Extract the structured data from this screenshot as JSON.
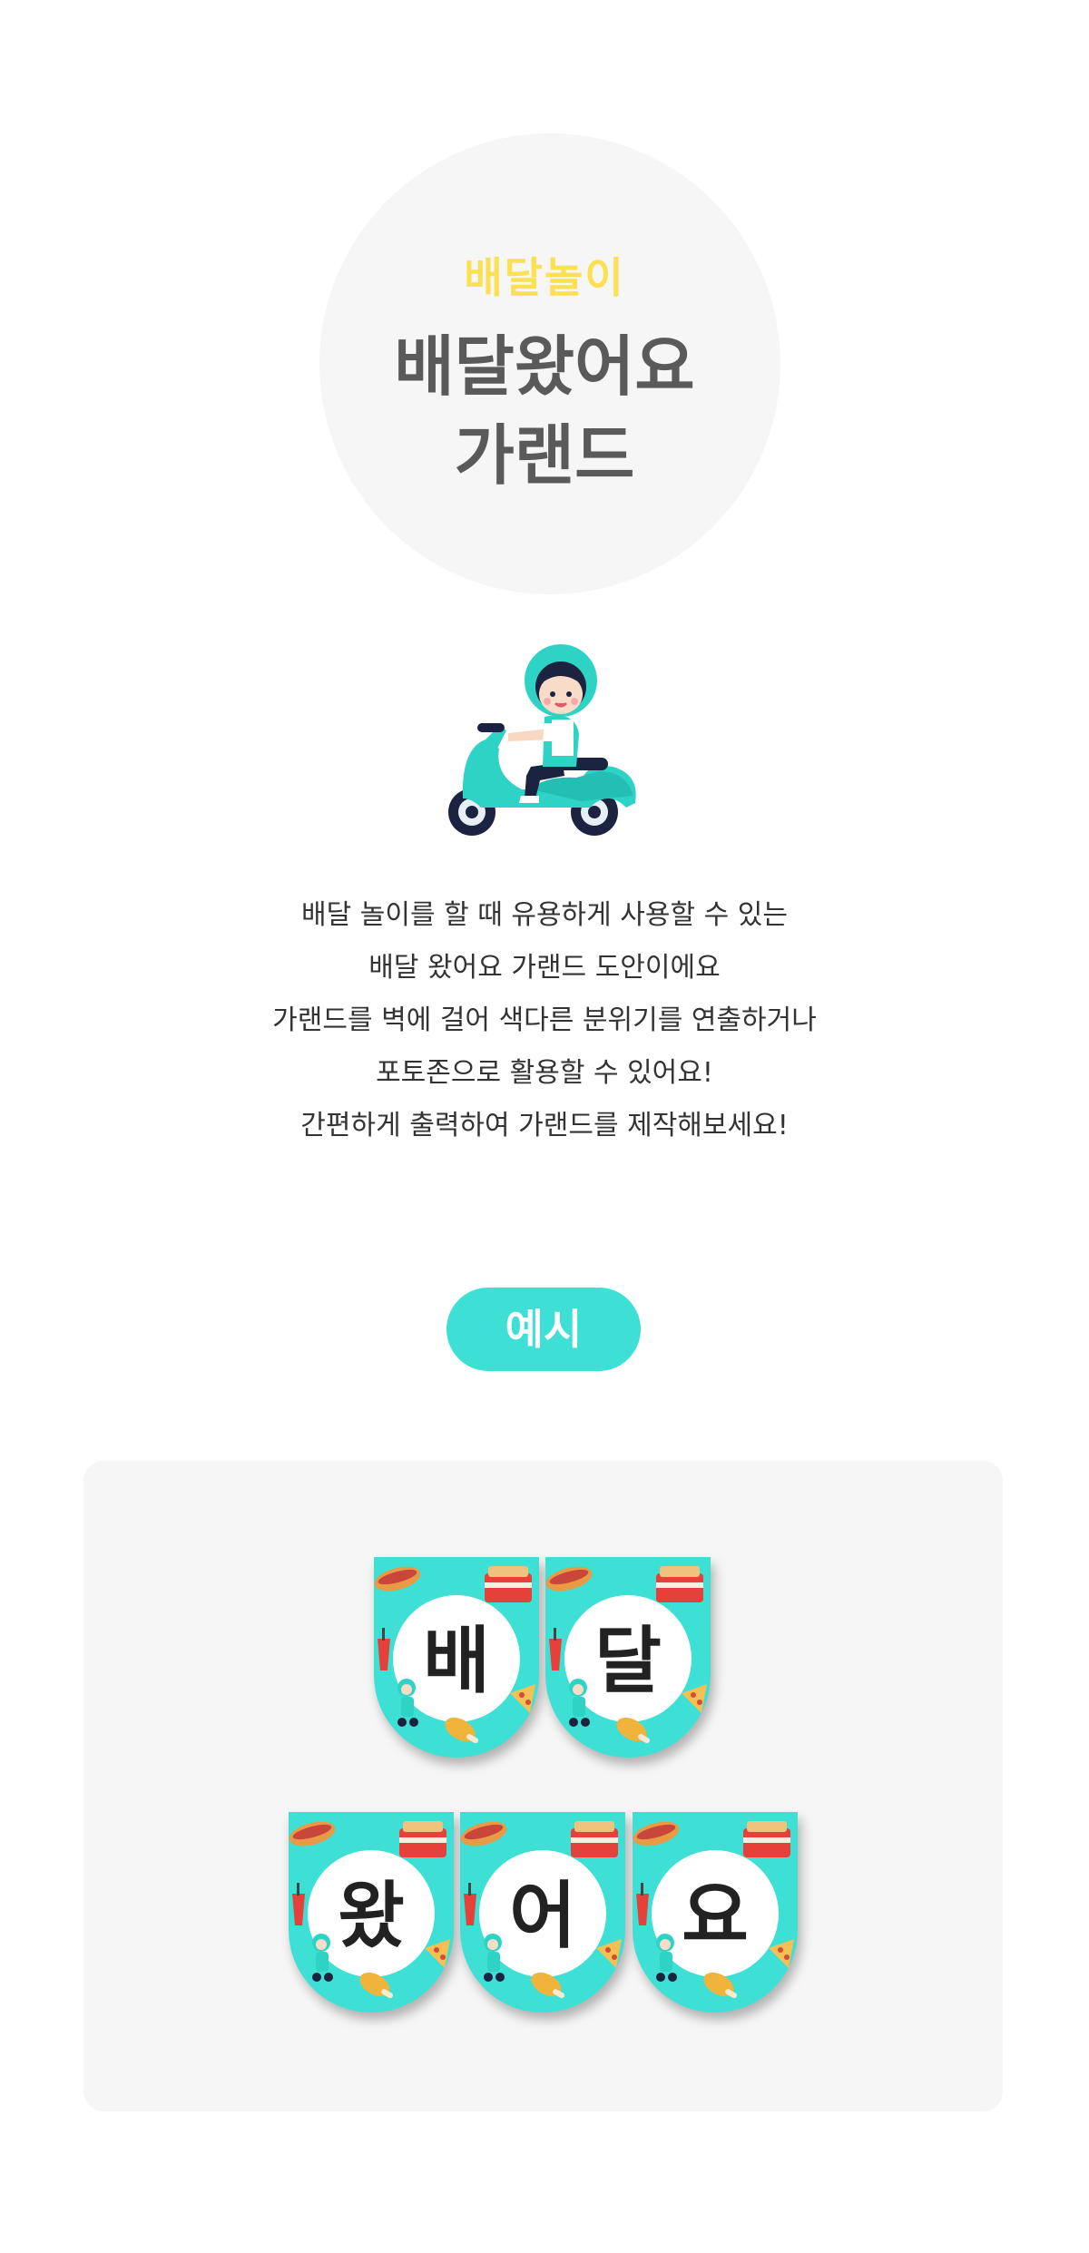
{
  "hero": {
    "subtitle": "배달놀이",
    "title_line1": "배달왔어요",
    "title_line2": "가랜드"
  },
  "description": [
    "배달 놀이를 할 때 유용하게 사용할 수 있는",
    "배달 왔어요 가랜드 도안이에요",
    "가랜드를 벽에 걸어 색다른 분위기를 연출하거나",
    "포토존으로 활용할 수 있어요!",
    "간편하게 출력하여 가랜드를 제작해보세요!"
  ],
  "example_label": "예시",
  "garland": {
    "row1": [
      "배",
      "달"
    ],
    "row2": [
      "왔",
      "어",
      "요"
    ]
  },
  "colors": {
    "accent_teal": "#3ee0d5",
    "subtitle_yellow": "#fbe052",
    "title_gray": "#5a5a5a",
    "panel_bg": "#f6f6f6"
  },
  "icons": [
    "delivery-scooter-icon",
    "hotdog-icon",
    "fried-chicken-box-icon",
    "drink-cup-icon",
    "pizza-icon",
    "chicken-leg-icon"
  ]
}
